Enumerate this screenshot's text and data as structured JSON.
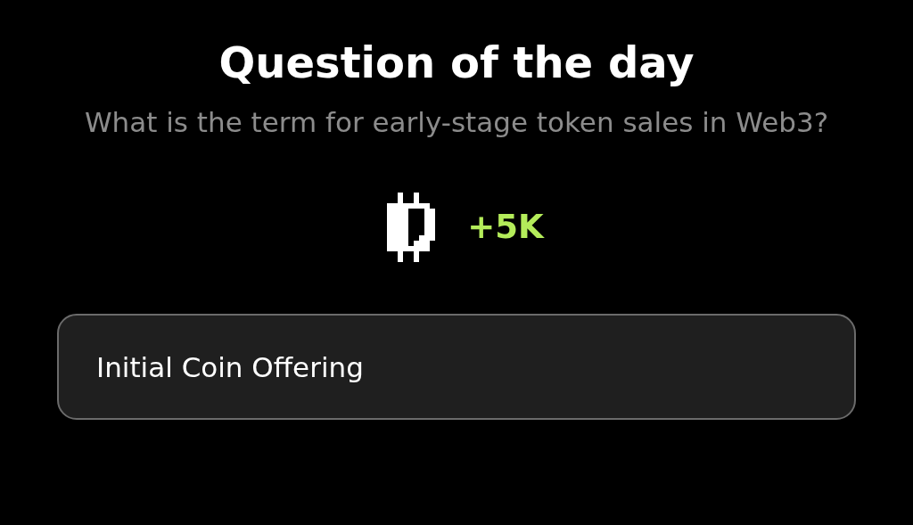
{
  "title": "Question of the day",
  "question": "What is the term for early-stage token sales in Web3?",
  "reward": {
    "amount": "+5K"
  },
  "answer": {
    "value": "Initial Coin Offering"
  }
}
